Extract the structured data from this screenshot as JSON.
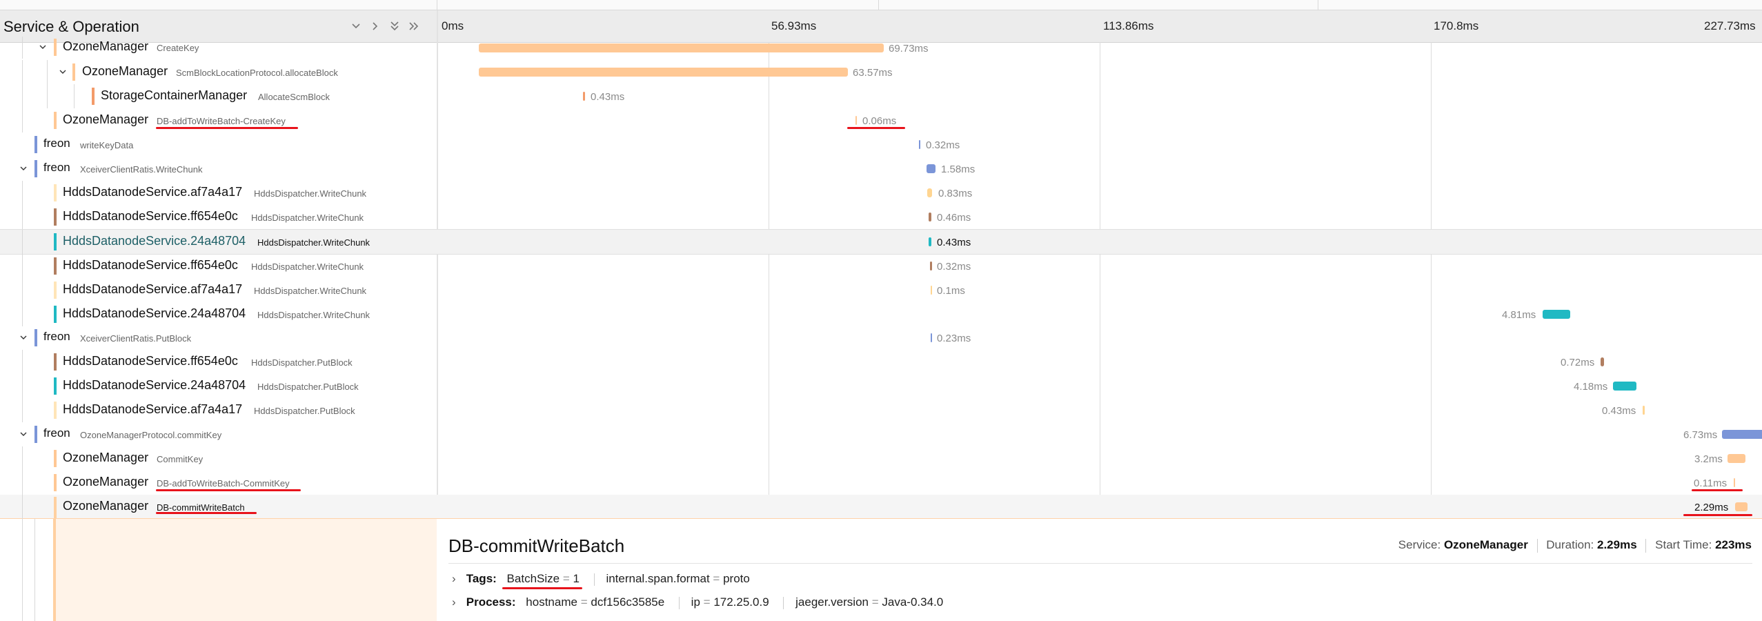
{
  "header": {
    "title": "Service & Operation",
    "ticks": [
      "0ms",
      "56.93ms",
      "113.86ms",
      "170.8ms",
      "227.73ms"
    ]
  },
  "colors": {
    "ozone": "#ffc894",
    "ozone_dark": "#f39b6a",
    "freon": "#7b95d8",
    "brown": "#b17e60",
    "teal": "#20b9c3",
    "pale": "#ffe5b8",
    "annotation_red": "#e8131b"
  },
  "rows": [
    {
      "service": "OzoneManager",
      "operation": "CreateKey",
      "duration": "69.73ms"
    },
    {
      "service": "OzoneManager",
      "operation": "ScmBlockLocationProtocol.allocateBlock",
      "duration": "63.57ms"
    },
    {
      "service": "StorageContainerManager",
      "operation": "AllocateScmBlock",
      "duration": "0.43ms"
    },
    {
      "service": "OzoneManager",
      "operation": "DB-addToWriteBatch-CreateKey",
      "duration": "0.06ms"
    },
    {
      "service": "freon",
      "operation": "writeKeyData",
      "duration": "0.32ms"
    },
    {
      "service": "freon",
      "operation": "XceiverClientRatis.WriteChunk",
      "duration": "1.58ms"
    },
    {
      "service": "HddsDatanodeService.af7a4a17",
      "operation": "HddsDispatcher.WriteChunk",
      "duration": "0.83ms"
    },
    {
      "service": "HddsDatanodeService.ff654e0c",
      "operation": "HddsDispatcher.WriteChunk",
      "duration": "0.46ms"
    },
    {
      "service": "HddsDatanodeService.24a48704",
      "operation": "HddsDispatcher.WriteChunk",
      "duration": "0.43ms"
    },
    {
      "service": "HddsDatanodeService.ff654e0c",
      "operation": "HddsDispatcher.WriteChunk",
      "duration": "0.32ms"
    },
    {
      "service": "HddsDatanodeService.af7a4a17",
      "operation": "HddsDispatcher.WriteChunk",
      "duration": "0.1ms"
    },
    {
      "service": "HddsDatanodeService.24a48704",
      "operation": "HddsDispatcher.WriteChunk",
      "duration": "4.81ms"
    },
    {
      "service": "freon",
      "operation": "XceiverClientRatis.PutBlock",
      "duration": "0.23ms"
    },
    {
      "service": "HddsDatanodeService.ff654e0c",
      "operation": "HddsDispatcher.PutBlock",
      "duration": "0.72ms"
    },
    {
      "service": "HddsDatanodeService.24a48704",
      "operation": "HddsDispatcher.PutBlock",
      "duration": "4.18ms"
    },
    {
      "service": "HddsDatanodeService.af7a4a17",
      "operation": "HddsDispatcher.PutBlock",
      "duration": "0.43ms"
    },
    {
      "service": "freon",
      "operation": "OzoneManagerProtocol.commitKey",
      "duration": "6.73ms"
    },
    {
      "service": "OzoneManager",
      "operation": "CommitKey",
      "duration": "3.2ms"
    },
    {
      "service": "OzoneManager",
      "operation": "DB-addToWriteBatch-CommitKey",
      "duration": "0.11ms"
    },
    {
      "service": "OzoneManager",
      "operation": "DB-commitWriteBatch",
      "duration": "2.29ms"
    }
  ],
  "detail": {
    "title": "DB-commitWriteBatch",
    "service_label": "Service:",
    "service_value": "OzoneManager",
    "duration_label": "Duration:",
    "duration_value": "2.29ms",
    "start_label": "Start Time:",
    "start_value": "223ms",
    "tags_label": "Tags:",
    "tags": [
      {
        "key": "BatchSize",
        "value": "1"
      },
      {
        "key": "internal.span.format",
        "value": "proto"
      }
    ],
    "process_label": "Process:",
    "process": [
      {
        "key": "hostname",
        "value": "dcf156c3585e"
      },
      {
        "key": "ip",
        "value": "172.25.0.9"
      },
      {
        "key": "jaeger.version",
        "value": "Java-0.34.0"
      }
    ]
  }
}
